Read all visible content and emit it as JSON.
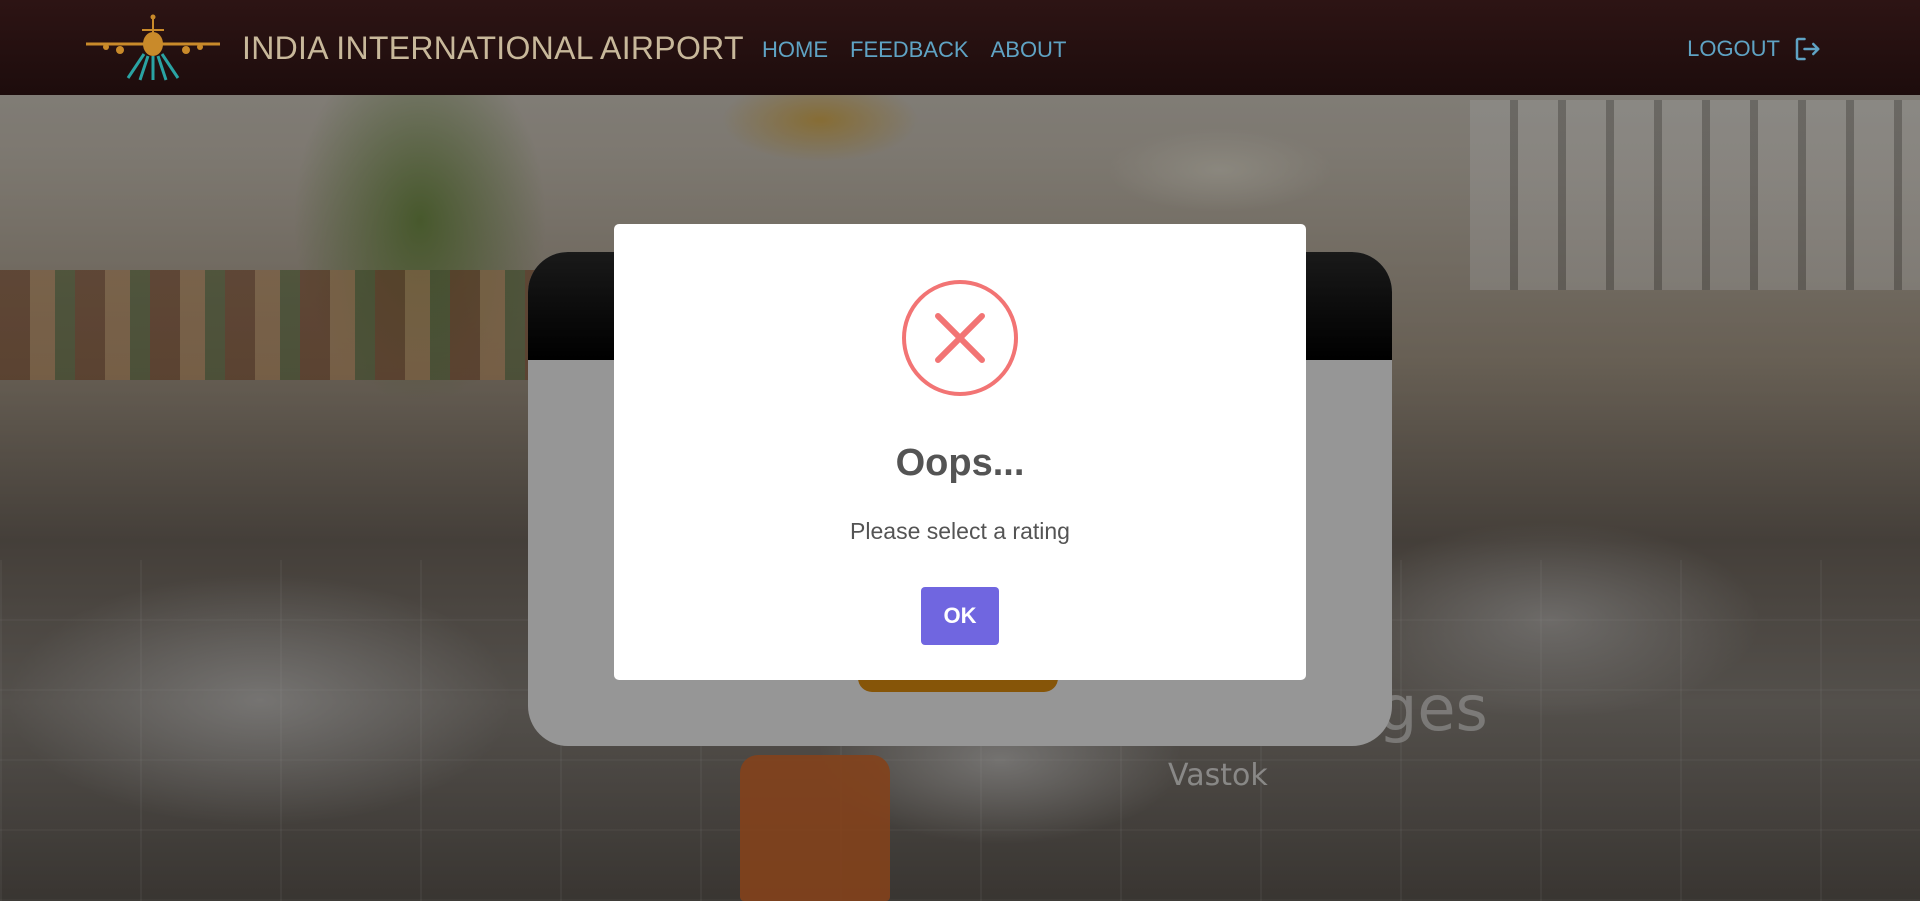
{
  "navbar": {
    "brand_title": "INDIA INTERNATIONAL AIRPORT",
    "links": [
      "HOME",
      "FEEDBACK",
      "ABOUT"
    ],
    "logout_label": "LOGOUT"
  },
  "background": {
    "watermark_small": "Vastok",
    "watermark_large": "ages"
  },
  "modal": {
    "icon": "error-x-icon",
    "title": "Oops...",
    "message": "Please select a rating",
    "confirm_label": "OK"
  },
  "colors": {
    "navbar": "#1d0c0c",
    "nav_link": "#5fa3c4",
    "brand": "#c8b89a",
    "error_icon": "#f27474",
    "confirm_button": "#7066e0"
  }
}
